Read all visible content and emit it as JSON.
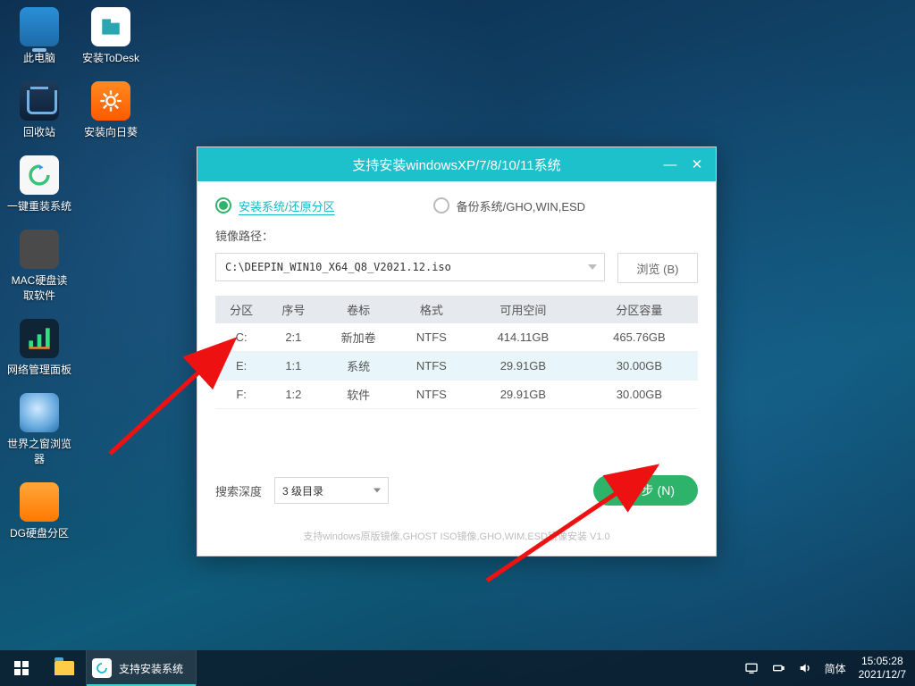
{
  "desktop_icons": {
    "this_pc": "此电脑",
    "todesk": "安装ToDesk",
    "recycle": "回收站",
    "sunflower": "安装向日葵",
    "reinstall": "一键重装系统",
    "macdisk": "MAC硬盘读取软件",
    "netpanel": "网络管理面板",
    "browser": "世界之窗浏览器",
    "dg": "DG硬盘分区"
  },
  "window": {
    "title": "支持安装windowsXP/7/8/10/11系统",
    "mode_install": "安装系统/还原分区",
    "mode_backup": "备份系统/GHO,WIN,ESD",
    "path_label": "镜像路径：",
    "path_value": "C:\\DEEPIN_WIN10_X64_Q8_V2021.12.iso",
    "browse_label": "浏览 (B)",
    "table": {
      "headers": [
        "分区",
        "序号",
        "卷标",
        "格式",
        "可用空间",
        "分区容量"
      ],
      "rows": [
        {
          "cells": [
            "C:",
            "2:1",
            "新加卷",
            "NTFS",
            "414.11GB",
            "465.76GB"
          ],
          "selected": false
        },
        {
          "cells": [
            "E:",
            "1:1",
            "系统",
            "NTFS",
            "29.91GB",
            "30.00GB"
          ],
          "selected": true
        },
        {
          "cells": [
            "F:",
            "1:2",
            "软件",
            "NTFS",
            "29.91GB",
            "30.00GB"
          ],
          "selected": false
        }
      ]
    },
    "depth_label": "搜索深度",
    "depth_value": "3 级目录",
    "next_label": "下一步 (N)",
    "footnote": "支持windows原版镜像,GHOST ISO镜像,GHO,WIM,ESD镜像安装  V1.0"
  },
  "taskbar": {
    "app_label": "支持安装系统",
    "ime": "简体",
    "time": "15:05:28",
    "date": "2021/12/7"
  }
}
